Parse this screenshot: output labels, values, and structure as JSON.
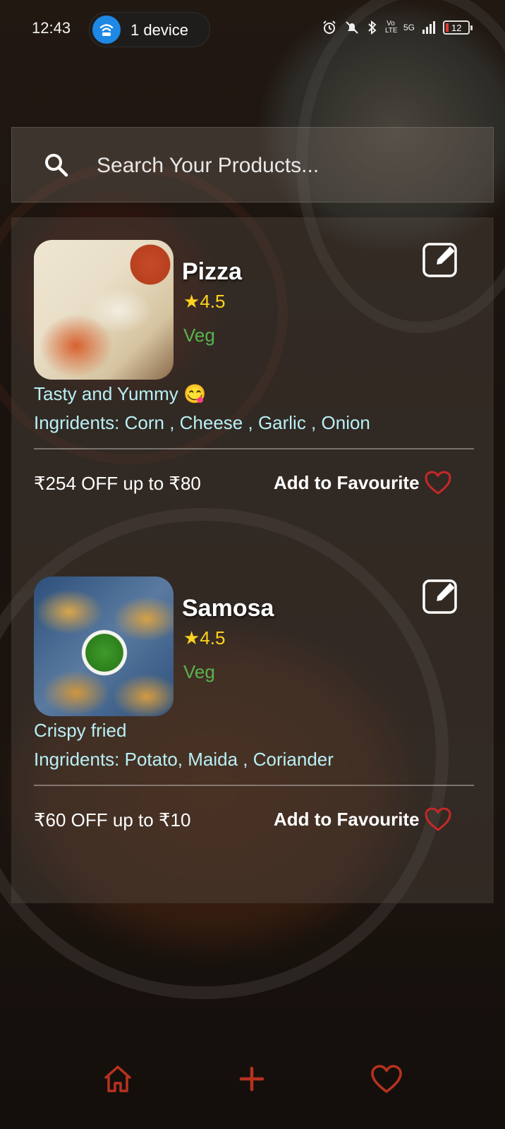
{
  "status_bar": {
    "time": "12:43",
    "hotspot_label": "1 device",
    "network": "5G",
    "volte": "Vo LTE",
    "battery": "12"
  },
  "search": {
    "placeholder": "Search Your Products..."
  },
  "products": [
    {
      "name": "Pizza",
      "rating": "4.5",
      "type": "Veg",
      "description": "Tasty and Yummy 😋",
      "ingredients": "Ingridents: Corn , Cheese , Garlic , Onion",
      "offer": "₹254 OFF up to ₹80",
      "fav_label": "Add to Favourite"
    },
    {
      "name": "Samosa",
      "rating": "4.5",
      "type": "Veg",
      "description": "Crispy fried",
      "ingredients": "Ingridents: Potato, Maida , Coriander",
      "offer": "₹60 OFF up to ₹10",
      "fav_label": "Add to Favourite"
    }
  ],
  "nav": {
    "items": [
      {
        "icon": "home-icon"
      },
      {
        "icon": "plus-icon"
      },
      {
        "icon": "heart-icon"
      }
    ]
  },
  "colors": {
    "accent_red": "#c62828",
    "rating_yellow": "#ffd21f",
    "veg_green": "#5ab34e",
    "text_cyan": "#b9f0f6"
  }
}
